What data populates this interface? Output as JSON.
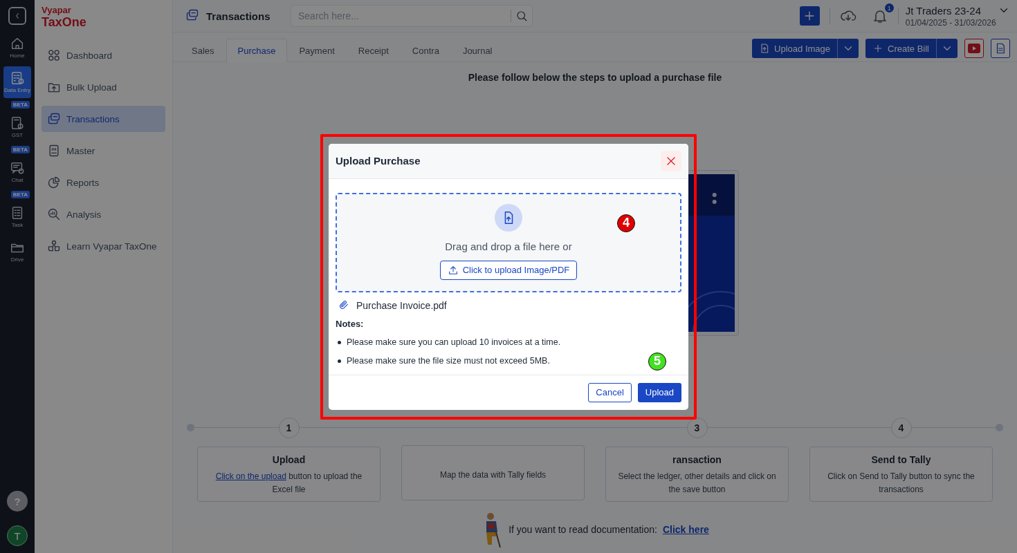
{
  "rail": {
    "items": [
      {
        "label": "Home",
        "selected": false
      },
      {
        "label": "Data Entry",
        "selected": true
      },
      {
        "label": "GST",
        "selected": false,
        "badge": "BETA"
      },
      {
        "label": "Chat",
        "selected": false,
        "badge": "BETA"
      },
      {
        "label": "Task",
        "selected": false,
        "badge": "BETA"
      },
      {
        "label": "Drive",
        "selected": false
      }
    ],
    "help": "?",
    "avatar": "T"
  },
  "sidebar": {
    "logo_top": "Vyapar",
    "logo_bottom": "TaxOne",
    "items": [
      {
        "label": "Dashboard",
        "selected": false
      },
      {
        "label": "Bulk Upload",
        "selected": false
      },
      {
        "label": "Transactions",
        "selected": true
      },
      {
        "label": "Master",
        "selected": false
      },
      {
        "label": "Reports",
        "selected": false
      },
      {
        "label": "Analysis",
        "selected": false
      },
      {
        "label": "Learn Vyapar TaxOne",
        "selected": false
      }
    ]
  },
  "header": {
    "title": "Transactions",
    "search": {
      "placeholder": "Search here..."
    },
    "notification_count": "1",
    "company": "Jt Traders 23-24",
    "period": "01/04/2025 - 31/03/2026"
  },
  "tabs": [
    {
      "label": "Sales",
      "selected": false
    },
    {
      "label": "Purchase",
      "selected": true
    },
    {
      "label": "Payment",
      "selected": false
    },
    {
      "label": "Receipt",
      "selected": false
    },
    {
      "label": "Contra",
      "selected": false
    },
    {
      "label": "Journal",
      "selected": false
    }
  ],
  "actions": {
    "upload_image": "Upload Image",
    "create_bill": "Create Bill"
  },
  "heading": "Please follow below the steps to upload a purchase file",
  "steps": [
    {
      "number": "1",
      "title": "Upload",
      "link": "Click on the upload",
      "description": "button to upload the Excel file"
    },
    {
      "description": "Map the data with Tally fields"
    },
    {
      "number": "3",
      "title": "ransaction",
      "description": "Select the ledger, other details and click on the save button"
    },
    {
      "number": "4",
      "title": "Send to Tally",
      "description": "Click on Send to Tally button to sync the transactions"
    }
  ],
  "documentation": {
    "text": "If you want to read documentation:",
    "link": "Click here"
  },
  "modal": {
    "title": "Upload Purchase",
    "drop_text": "Drag and drop a file here or",
    "browse_button": "Click to upload Image/PDF",
    "file_name": "Purchase Invoice.pdf",
    "notes_title": "Notes:",
    "notes": [
      "Please make sure you can upload 10 invoices at a time.",
      "Please make sure the file size must not exceed 5MB."
    ],
    "cancel": "Cancel",
    "upload": "Upload"
  },
  "annotations": [
    {
      "number": "4",
      "color": "#e00000"
    },
    {
      "number": "5",
      "color": "#44e022"
    }
  ]
}
